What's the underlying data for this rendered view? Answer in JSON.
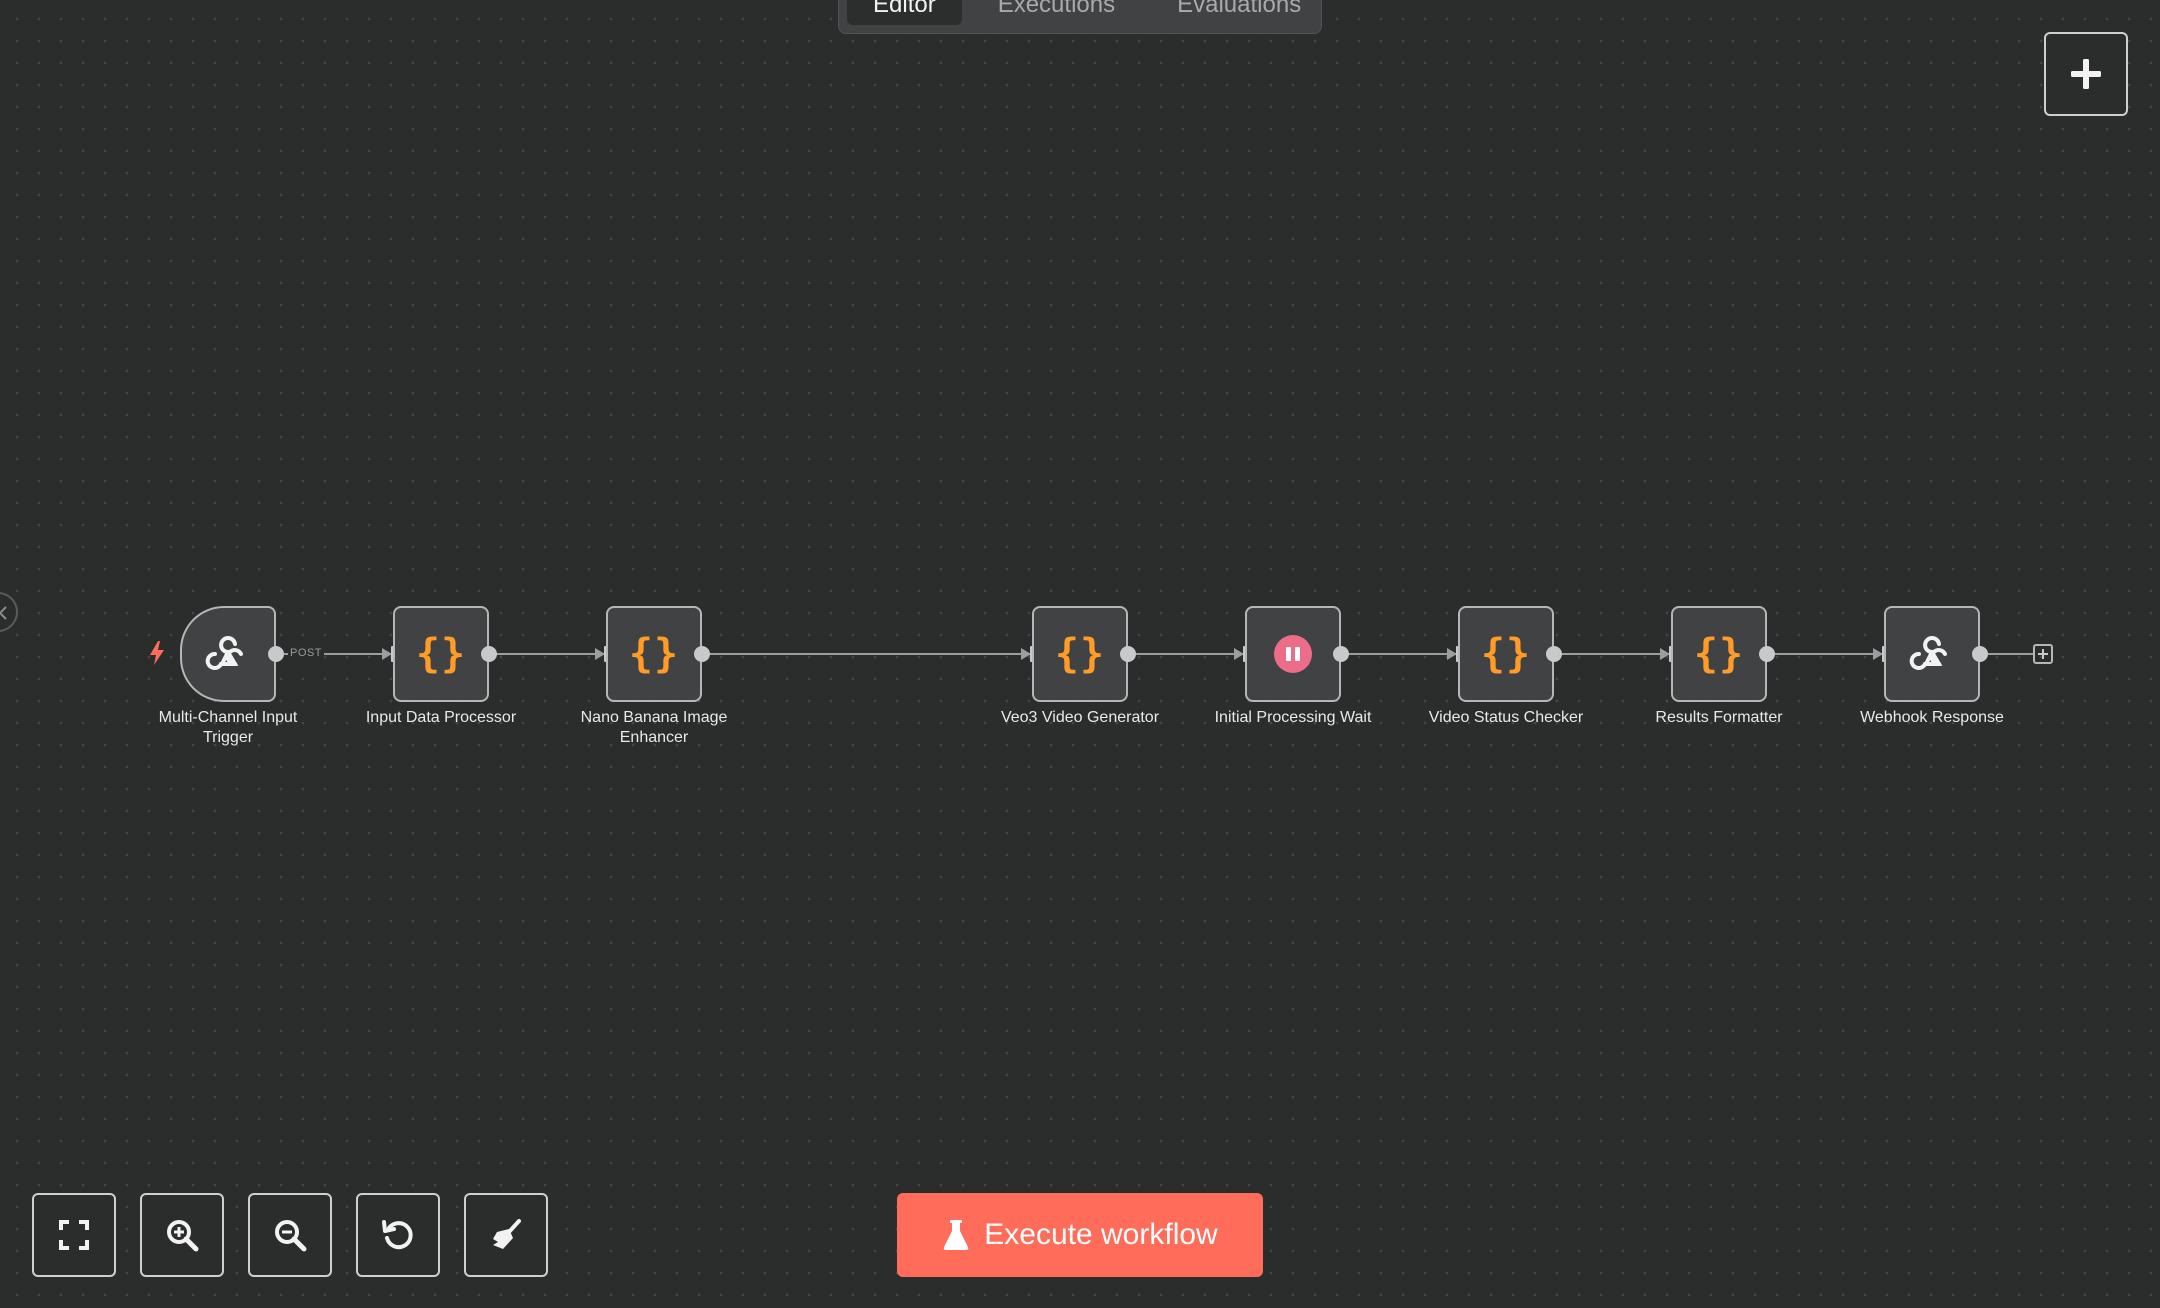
{
  "tabs": [
    {
      "label": "Editor",
      "active": true
    },
    {
      "label": "Executions",
      "active": false
    },
    {
      "label": "Evaluations",
      "active": false
    }
  ],
  "nodes": [
    {
      "label_line1": "Multi-Channel Input",
      "label_line2": "Trigger",
      "icon": "webhook-icon"
    },
    {
      "label_line1": "Input Data Processor",
      "label_line2": "",
      "icon": "code-braces-icon"
    },
    {
      "label_line1": "Nano Banana Image",
      "label_line2": "Enhancer",
      "icon": "code-braces-icon"
    },
    {
      "label_line1": "Veo3 Video Generator",
      "label_line2": "",
      "icon": "code-braces-icon"
    },
    {
      "label_line1": "Initial Processing Wait",
      "label_line2": "",
      "icon": "pause-icon"
    },
    {
      "label_line1": "Video Status Checker",
      "label_line2": "",
      "icon": "code-braces-icon"
    },
    {
      "label_line1": "Results Formatter",
      "label_line2": "",
      "icon": "code-braces-icon"
    },
    {
      "label_line1": "Webhook Response",
      "label_line2": "",
      "icon": "webhook-icon"
    }
  ],
  "trigger_connection_label": "POST",
  "code_glyph": "{}",
  "execute_button": {
    "label": "Execute workflow",
    "color": "#ff6d5a"
  },
  "colors": {
    "canvas": "#2b2c2c",
    "node_fill": "#414243",
    "node_border": "#b5b6b7",
    "code_icon": "#ff9b27",
    "wait_icon": "#ec6d8a",
    "trigger_bolt": "#ff6d5a"
  },
  "controls": [
    "zoom-to-fit-icon",
    "zoom-in-icon",
    "zoom-out-icon",
    "reset-zoom-icon",
    "tidy-up-icon"
  ]
}
